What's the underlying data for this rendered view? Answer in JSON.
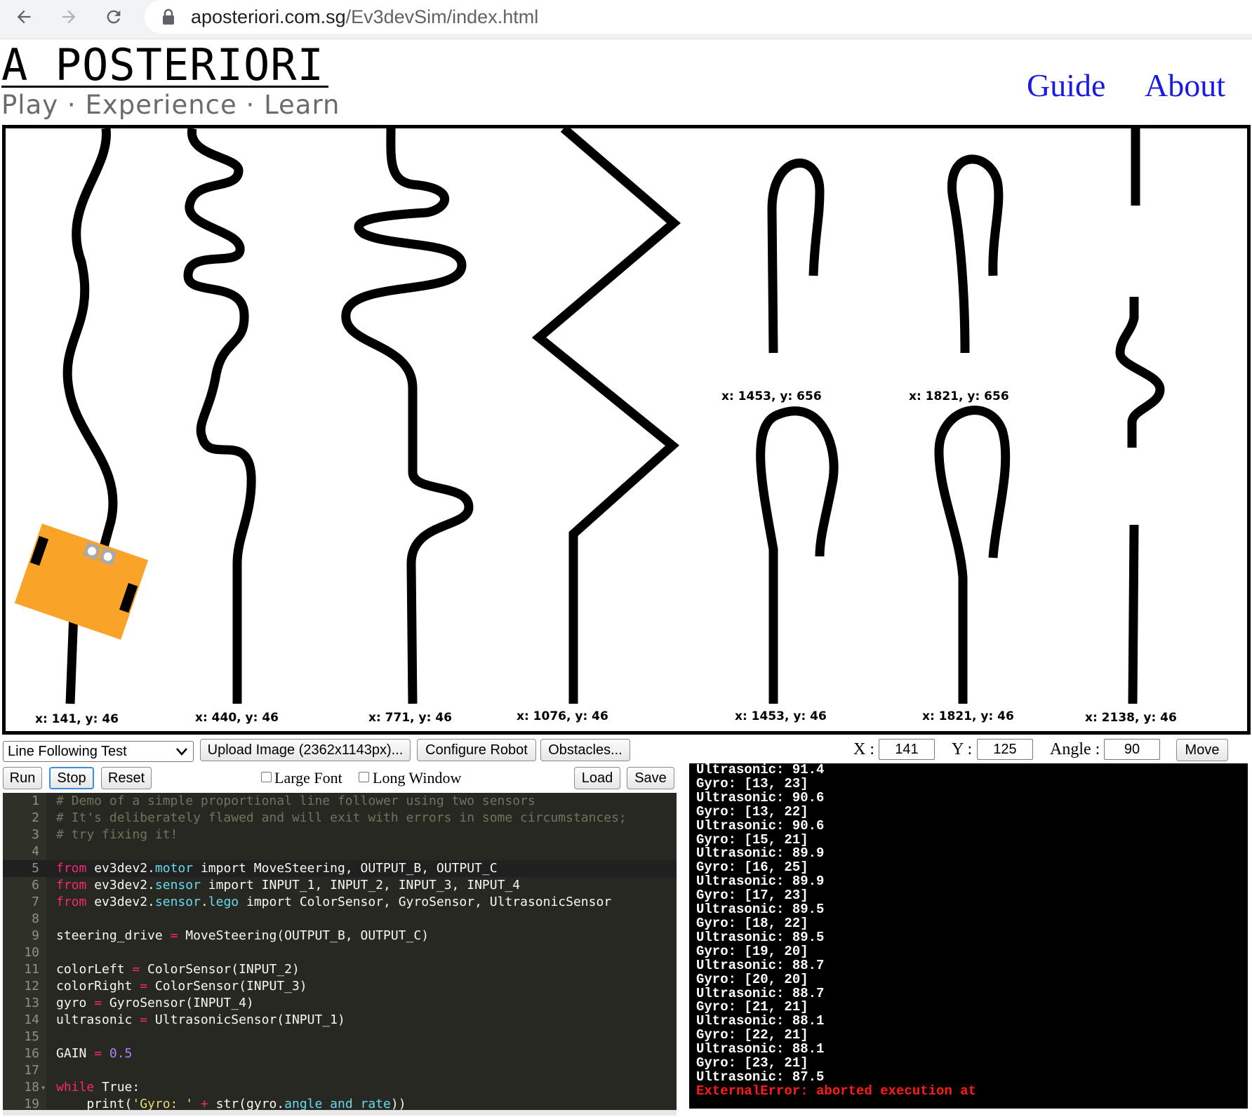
{
  "browser": {
    "url_host": "aposteriori.com.sg",
    "url_path": "/Ev3devSim/index.html"
  },
  "site": {
    "logo": "A POSTERIORI",
    "tagline": "Play · Experience · Learn",
    "nav": [
      "Guide",
      "About"
    ]
  },
  "field_labels": [
    "x: 141, y: 46",
    "x: 440, y: 46",
    "x: 771, y: 46",
    "x: 1076, y: 46",
    "x: 1453, y: 46",
    "x: 1821, y: 46",
    "x: 2138, y: 46",
    "x: 1453, y: 656",
    "x: 1821, y: 656"
  ],
  "robot": {
    "color": "#f9a329",
    "sensor_color": "#a9a9a9"
  },
  "toolbar": {
    "world_select": "Line Following Test",
    "upload_button": "Upload Image (2362x1143px)...",
    "configure_button": "Configure Robot",
    "obstacles_button": "Obstacles...",
    "x_label": "X :",
    "x_value": "141",
    "y_label": "Y :",
    "y_value": "125",
    "angle_label": "Angle :",
    "angle_value": "90",
    "move_button": "Move"
  },
  "controls": {
    "run": "Run",
    "stop": "Stop",
    "reset": "Reset",
    "large_font": "Large Font",
    "long_window": "Long Window",
    "load": "Load",
    "save": "Save"
  },
  "editor": {
    "active_line": 5,
    "lines": [
      "# Demo of a simple proportional line follower using two sensors",
      "# It's deliberately flawed and will exit with errors in some circumstances;",
      "# try fixing it!",
      "",
      "from ev3dev2.motor import MoveSteering, OUTPUT_B, OUTPUT_C",
      "from ev3dev2.sensor import INPUT_1, INPUT_2, INPUT_3, INPUT_4",
      "from ev3dev2.sensor.lego import ColorSensor, GyroSensor, UltrasonicSensor",
      "",
      "steering_drive = MoveSteering(OUTPUT_B, OUTPUT_C)",
      "",
      "colorLeft = ColorSensor(INPUT_2)",
      "colorRight = ColorSensor(INPUT_3)",
      "gyro = GyroSensor(INPUT_4)",
      "ultrasonic = UltrasonicSensor(INPUT_1)",
      "",
      "GAIN = 0.5",
      "",
      "while True:",
      "    print('Gyro: ' + str(gyro.angle_and_rate))"
    ]
  },
  "console": {
    "lines": [
      "Ultrasonic: 91.4",
      "Gyro: [13, 23]",
      "Ultrasonic: 90.6",
      "Gyro: [13, 22]",
      "Ultrasonic: 90.6",
      "Gyro: [15, 21]",
      "Ultrasonic: 89.9",
      "Gyro: [16, 25]",
      "Ultrasonic: 89.9",
      "Gyro: [17, 23]",
      "Ultrasonic: 89.5",
      "Gyro: [18, 22]",
      "Ultrasonic: 89.5",
      "Gyro: [19, 20]",
      "Ultrasonic: 88.7",
      "Gyro: [20, 20]",
      "Ultrasonic: 88.7",
      "Gyro: [21, 21]",
      "Ultrasonic: 88.1",
      "Gyro: [22, 21]",
      "Ultrasonic: 88.1",
      "Gyro: [23, 21]",
      "Ultrasonic: 87.5"
    ],
    "error": "ExternalError: aborted execution at"
  }
}
